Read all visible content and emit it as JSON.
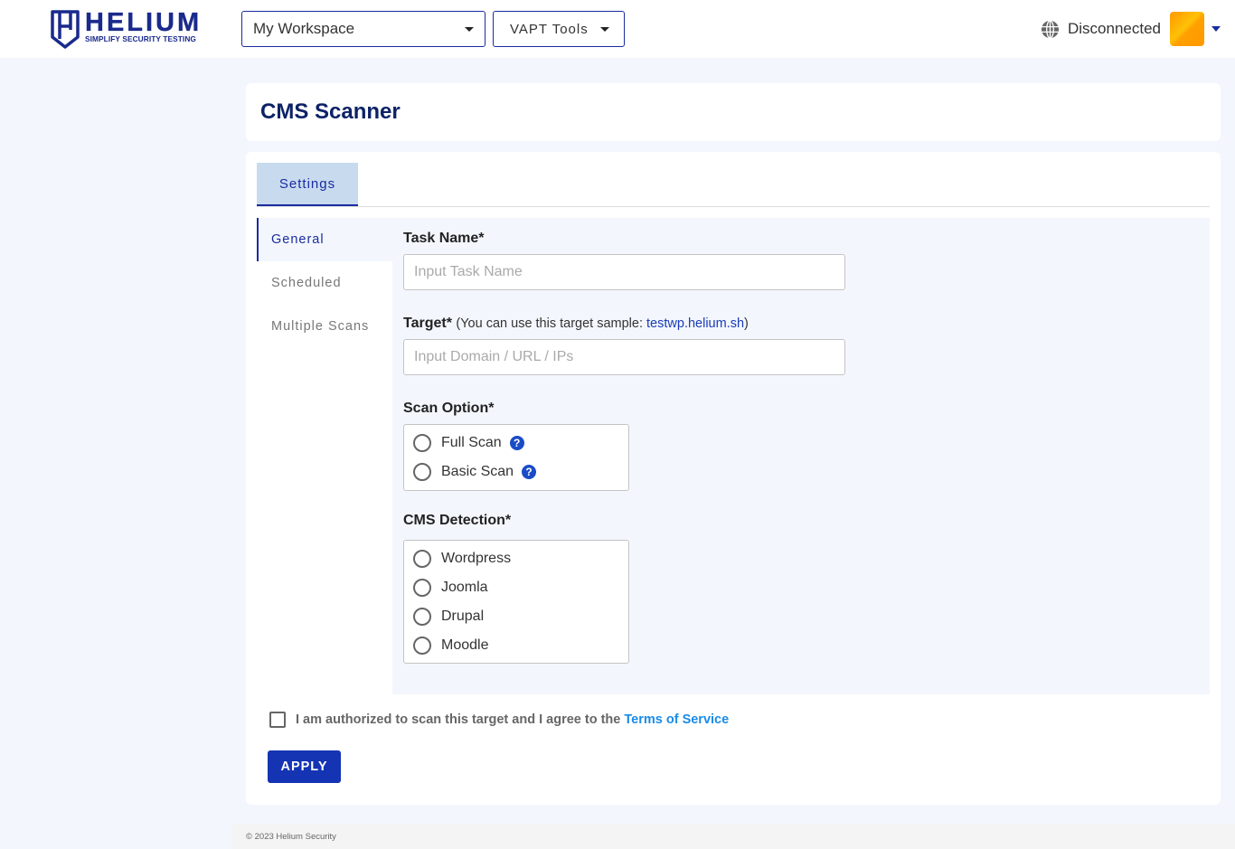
{
  "header": {
    "logo": {
      "name": "HELIUM",
      "tagline": "SIMPLIFY SECURITY TESTING",
      "icon": "shield-icon"
    },
    "workspace_dropdown": {
      "selected": "My Workspace"
    },
    "tools_dropdown": {
      "selected": "VAPT Tools"
    },
    "connection": {
      "icon": "globe-icon",
      "status": "Disconnected"
    },
    "avatar": {
      "icon": "avatar",
      "menu_icon": "caret-down-icon"
    }
  },
  "page": {
    "title": "CMS Scanner"
  },
  "tabs": [
    {
      "label": "Settings",
      "active": true
    }
  ],
  "side_nav": [
    {
      "label": "General",
      "active": true
    },
    {
      "label": "Scheduled",
      "active": false
    },
    {
      "label": "Multiple Scans",
      "active": false
    }
  ],
  "form": {
    "task_name": {
      "label": "Task Name*",
      "placeholder": "Input Task Name",
      "value": ""
    },
    "target": {
      "label": "Target*",
      "note_prefix": "(You can use this target sample: ",
      "sample_link": "testwp.helium.sh",
      "note_suffix": ")",
      "placeholder": "Input Domain / URL / IPs",
      "value": ""
    },
    "scan_option": {
      "label": "Scan Option*",
      "options": [
        {
          "label": "Full Scan",
          "selected": false,
          "help_icon": "question-circle-icon"
        },
        {
          "label": "Basic Scan",
          "selected": false,
          "help_icon": "question-circle-icon"
        }
      ]
    },
    "cms_detection": {
      "label": "CMS Detection*",
      "options": [
        {
          "label": "Wordpress",
          "selected": false
        },
        {
          "label": "Joomla",
          "selected": false
        },
        {
          "label": "Drupal",
          "selected": false
        },
        {
          "label": "Moodle",
          "selected": false
        }
      ]
    },
    "agreement": {
      "checked": false,
      "text": "I am authorized to scan this target and I agree to the ",
      "link": "Terms of Service"
    },
    "apply_label": "APPLY"
  },
  "footer": {
    "text": "© 2023 Helium Security"
  },
  "colors": {
    "brand": "#1a2ca0",
    "title": "#0d2266",
    "link": "#1a8be8",
    "button": "#1434b4"
  }
}
